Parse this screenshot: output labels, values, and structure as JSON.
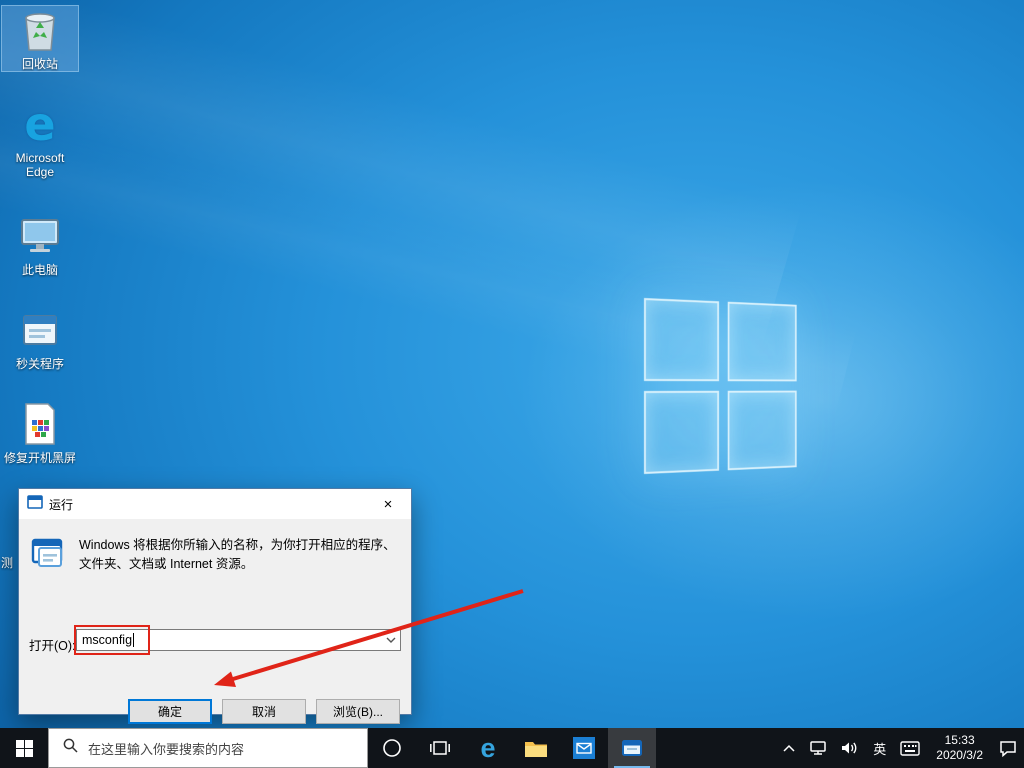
{
  "colors": {
    "accent_red": "#e02418",
    "focus_blue": "#0078d7"
  },
  "desktop": {
    "icons": [
      {
        "label": "回收站"
      },
      {
        "label": "Microsoft Edge"
      },
      {
        "label": "此电脑"
      },
      {
        "label": "秒关程序"
      },
      {
        "label": "修复开机黑屏"
      }
    ],
    "partial_icon_label": "测"
  },
  "run_dialog": {
    "title": "运行",
    "description_line1": "Windows 将根据你所输入的名称，为你打开相应的程序、",
    "description_line2": "文件夹、文档或 Internet 资源。",
    "open_label": "打开(O):",
    "input_value": "msconfig",
    "close_glyph": "×",
    "buttons": {
      "ok": "确定",
      "cancel": "取消",
      "browse": "浏览(B)..."
    }
  },
  "taskbar": {
    "search_placeholder": "在这里输入你要搜索的内容",
    "ime_indicator": "英",
    "clock": {
      "time": "15:33",
      "date": "2020/3/2"
    }
  }
}
